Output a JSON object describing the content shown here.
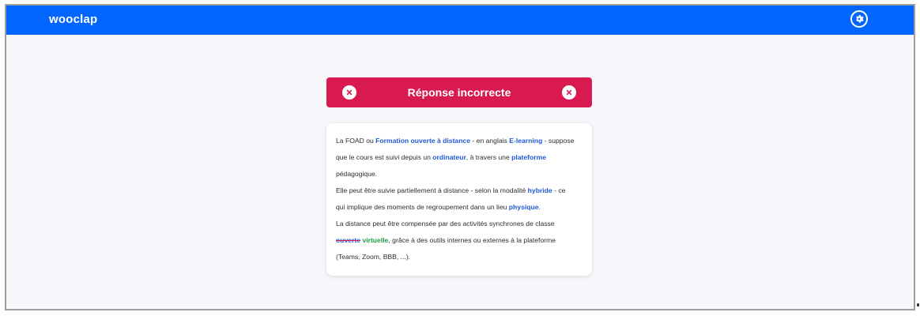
{
  "header": {
    "logo": "wooclap"
  },
  "result": {
    "title": "Réponse incorrecte"
  },
  "answer": {
    "line1": {
      "t1": "La FOAD ou ",
      "k1": "Formation ouverte à distance",
      "t2": " - en anglais ",
      "k2": "E-learning",
      "t3": " - suppose"
    },
    "line2": {
      "t1": "que le cours est suivi depuis un ",
      "k1": "ordinateur",
      "t2": ", à travers une ",
      "k2": "plateforme"
    },
    "line3": {
      "t1": "pédagogique."
    },
    "line4": {
      "t1": "Elle peut être suivie partiellement à distance - selon la modalité ",
      "k1": "hybride",
      "t2": " - ce"
    },
    "line5": {
      "t1": "qui implique des moments de regroupement dans un lieu ",
      "k1": "physique",
      "t2": "."
    },
    "line6": {
      "t1": "La distance peut être compensée par des activités synchrones de classe"
    },
    "line7": {
      "wrong": "ouverte",
      "correct": "virtuelle",
      "t1": ", grâce à des outils internes ou externes à la plateforme"
    },
    "line8": {
      "t1": "(Teams, Zoom, BBB, ...)."
    }
  },
  "colors": {
    "topbar": "#0066ff",
    "banner": "#d91a50",
    "keyword": "#1f5ad6",
    "correct": "#1aa04a"
  },
  "icons": {
    "settings": "gear-icon",
    "incorrect": "close-icon"
  }
}
